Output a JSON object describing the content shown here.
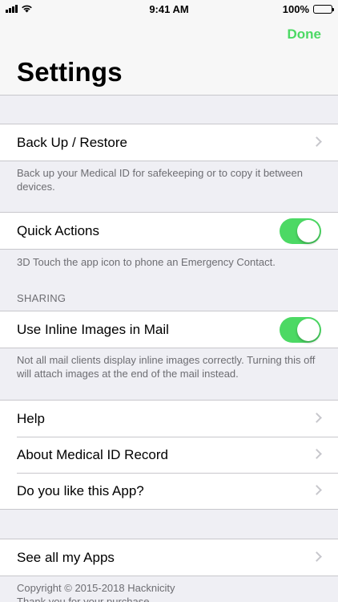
{
  "status_bar": {
    "time": "9:41 AM",
    "battery": "100%"
  },
  "nav": {
    "title": "Settings",
    "done_label": "Done"
  },
  "rows": {
    "backup": "Back Up / Restore",
    "quick_actions": "Quick Actions",
    "inline_images": "Use Inline Images in Mail",
    "help": "Help",
    "about": "About Medical ID Record",
    "like": "Do you like this App?",
    "see_apps": "See all my Apps"
  },
  "toggles": {
    "quick_actions": true,
    "inline_images": true
  },
  "footers": {
    "backup": "Back up your Medical ID for safekeeping or to copy it between devices.",
    "quick_actions": "3D Touch the app icon to phone an Emergency Contact.",
    "inline_images": "Not all mail clients display inline images correctly. Turning this off will attach images at the end of the mail instead.",
    "copyright": "Copyright © 2015-2018 Hacknicity",
    "thanks": "Thank you for your purchase"
  },
  "headers": {
    "sharing": "SHARING"
  },
  "colors": {
    "accent": "#4cd964",
    "background": "#efeff4",
    "secondary_text": "#6d6d72"
  },
  "icons": {
    "signal": "cellular-signal-icon",
    "wifi": "wifi-icon",
    "battery": "battery-icon",
    "chevron": "chevron-right-icon"
  }
}
